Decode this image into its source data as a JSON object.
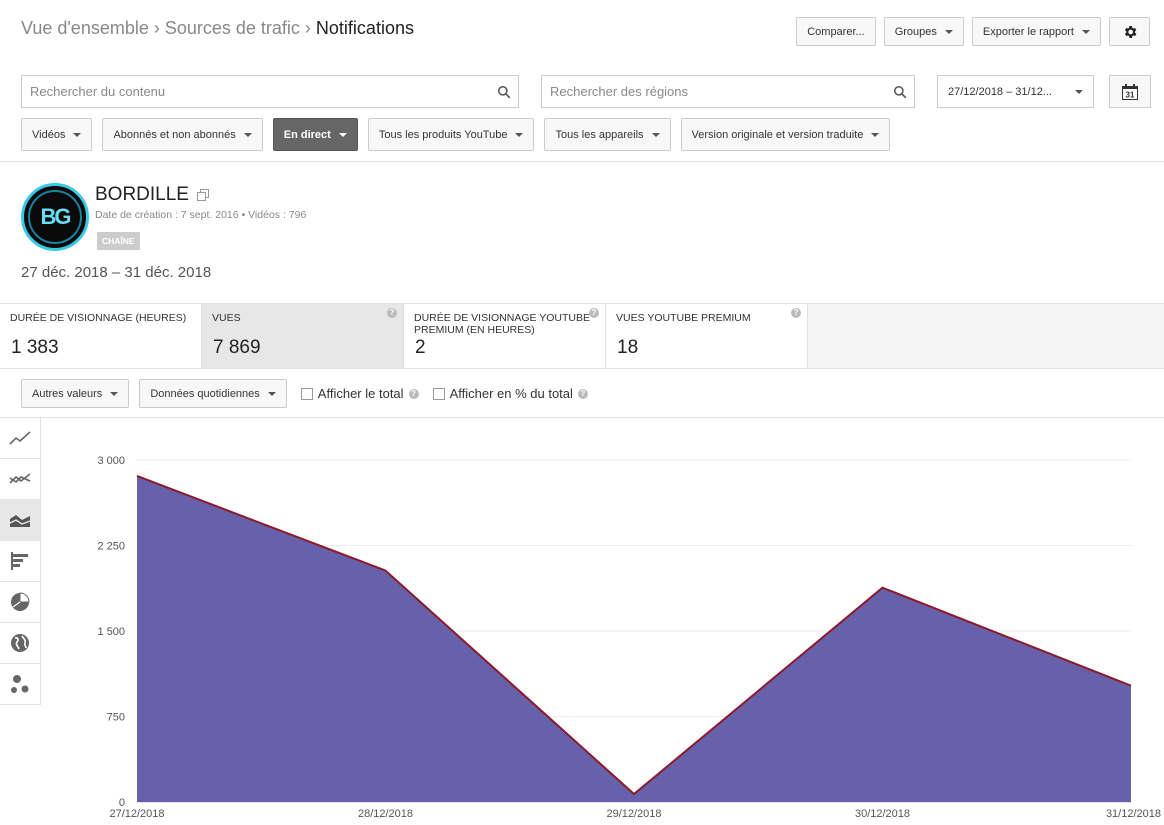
{
  "breadcrumb": {
    "items": [
      "Vue d'ensemble",
      "Sources de trafic"
    ],
    "separator": "›",
    "current": "Notifications"
  },
  "header_actions": {
    "compare": "Comparer...",
    "groups": "Groupes",
    "export": "Exporter le rapport",
    "settings_icon": "gear-icon"
  },
  "search": {
    "content_placeholder": "Rechercher du contenu",
    "regions_placeholder": "Rechercher des régions",
    "date_value": "27/12/2018 – 31/12...",
    "calendar_icon": "calendar-icon",
    "calendar_day": "31"
  },
  "filters": [
    {
      "label": "Vidéos",
      "active": false
    },
    {
      "label": "Abonnés et non abonnés",
      "active": false
    },
    {
      "label": "En direct",
      "active": true
    },
    {
      "label": "Tous les produits YouTube",
      "active": false
    },
    {
      "label": "Tous les appareils",
      "active": false
    },
    {
      "label": "Version originale et version traduite",
      "active": false
    }
  ],
  "channel": {
    "name": "BORDILLE",
    "avatar_text": "BG",
    "meta": "Date de création : 7 sept. 2016  •  Vidéos : 796",
    "badge": "CHAÎNE",
    "date_range": "27 déc. 2018 – 31 déc. 2018"
  },
  "metrics": [
    {
      "label": "Durée de visionnage (heures)",
      "value": "1 383",
      "selected": false,
      "help": false
    },
    {
      "label": "Vues",
      "value": "7 869",
      "selected": true,
      "help": true
    },
    {
      "label": "Durée de visionnage YouTube Premium (en heures)",
      "value": "2",
      "selected": false,
      "help": true
    },
    {
      "label": "Vues YouTube Premium",
      "value": "18",
      "selected": false,
      "help": true
    }
  ],
  "options": {
    "other_values": "Autres valeurs",
    "daily_data": "Données quotidiennes",
    "show_total": "Afficher le total",
    "show_pct": "Afficher en % du total"
  },
  "sidebar_icons": [
    "line-chart-icon",
    "multi-line-chart-icon",
    "area-chart-icon",
    "bar-chart-icon",
    "pie-chart-icon",
    "globe-icon",
    "bubble-chart-icon"
  ],
  "colors": {
    "area_fill": "#6761ab",
    "line": "#8b1a2a",
    "active_filter": "#666666"
  },
  "chart_data": {
    "type": "area",
    "x": [
      "27/12/2018",
      "28/12/2018",
      "29/12/2018",
      "30/12/2018",
      "31/12/2018"
    ],
    "series": [
      {
        "values": [
          2860,
          2030,
          70,
          1880,
          1020
        ]
      }
    ],
    "ylim": [
      0,
      3000
    ],
    "yticks": [
      0,
      750,
      1500,
      2250,
      3000
    ],
    "ytick_labels": [
      "0",
      "750",
      "1 500",
      "2 250",
      "3 000"
    ],
    "grid": true
  }
}
